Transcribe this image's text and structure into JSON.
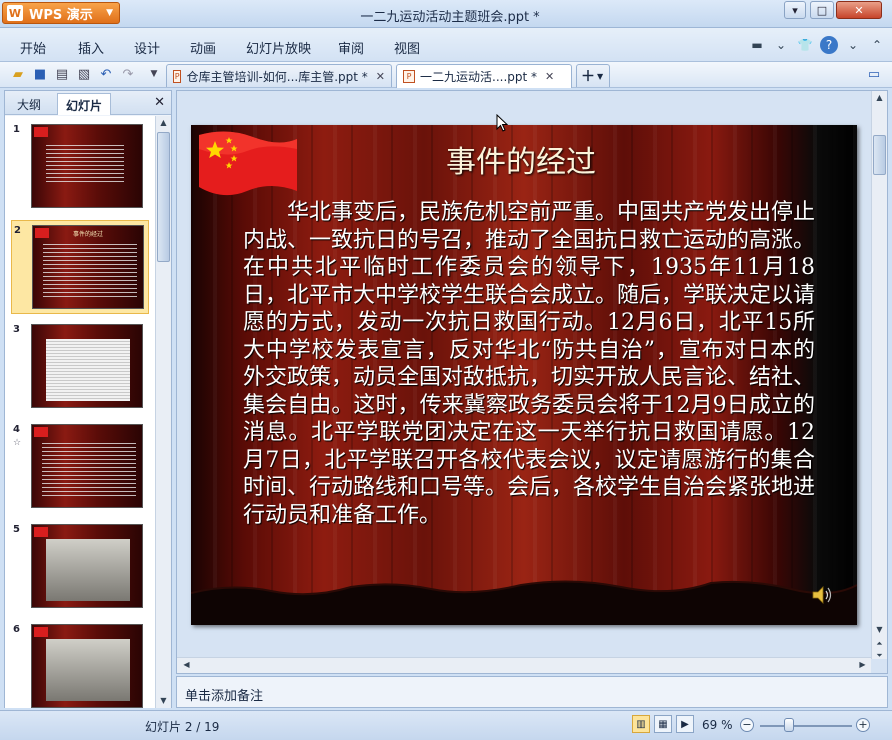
{
  "app": {
    "name": "WPS 演示",
    "logo_letter": "W",
    "window_title": "一二九运动活动主题班会.ppt *"
  },
  "menu": {
    "items": [
      "开始",
      "插入",
      "设计",
      "动画",
      "幻灯片放映",
      "审阅",
      "视图"
    ]
  },
  "tabs": [
    {
      "label": "仓库主管培训-如何...库主管.ppt *",
      "active": false
    },
    {
      "label": "一二九运动活....ppt *",
      "active": true
    }
  ],
  "left_panel": {
    "tabs": [
      "大纲",
      "幻灯片"
    ],
    "active_tab": "幻灯片",
    "slides": [
      {
        "num": "1",
        "title": "",
        "kind": "title"
      },
      {
        "num": "2",
        "title": "事件的经过",
        "kind": "text",
        "selected": true
      },
      {
        "num": "3",
        "title": "",
        "kind": "doc"
      },
      {
        "num": "4",
        "title": "",
        "kind": "text"
      },
      {
        "num": "5",
        "title": "",
        "kind": "photo"
      },
      {
        "num": "6",
        "title": "",
        "kind": "photo"
      }
    ]
  },
  "slide": {
    "title": "事件的经过",
    "body": "华北事变后，民族危机空前严重。中国共产党发出停止内战、一致抗日的号召，推动了全国抗日救亡运动的高涨。在中共北平临时工作委员会的领导下，1935年11月18日，北平市大中学校学生联合会成立。随后，学联决定以请愿的方式，发动一次抗日救国行动。12月6日，北平15所大中学校发表宣言，反对华北“防共自治”，宣布对日本的外交政策，动员全国对敌抵抗，切实开放人民言论、结社、集会自由。这时，传来冀察政务委员会将于12月9日成立的消息。北平学联党团决定在这一天举行抗日救国请愿。12月7日，北平学联召开各校代表会议，议定请愿游行的集合时间、行动路线和口号等。会后，各校学生自治会紧张地进行动员和准备工作。"
  },
  "notes": {
    "placeholder": "单击添加备注"
  },
  "status": {
    "slide_info": "幻灯片 2 / 19",
    "zoom": "69 %",
    "zoom_level": 0.69
  },
  "colors": {
    "accent_orange": "#e0701a",
    "slide_red": "#8e1c10",
    "selection": "#fde7a3"
  }
}
